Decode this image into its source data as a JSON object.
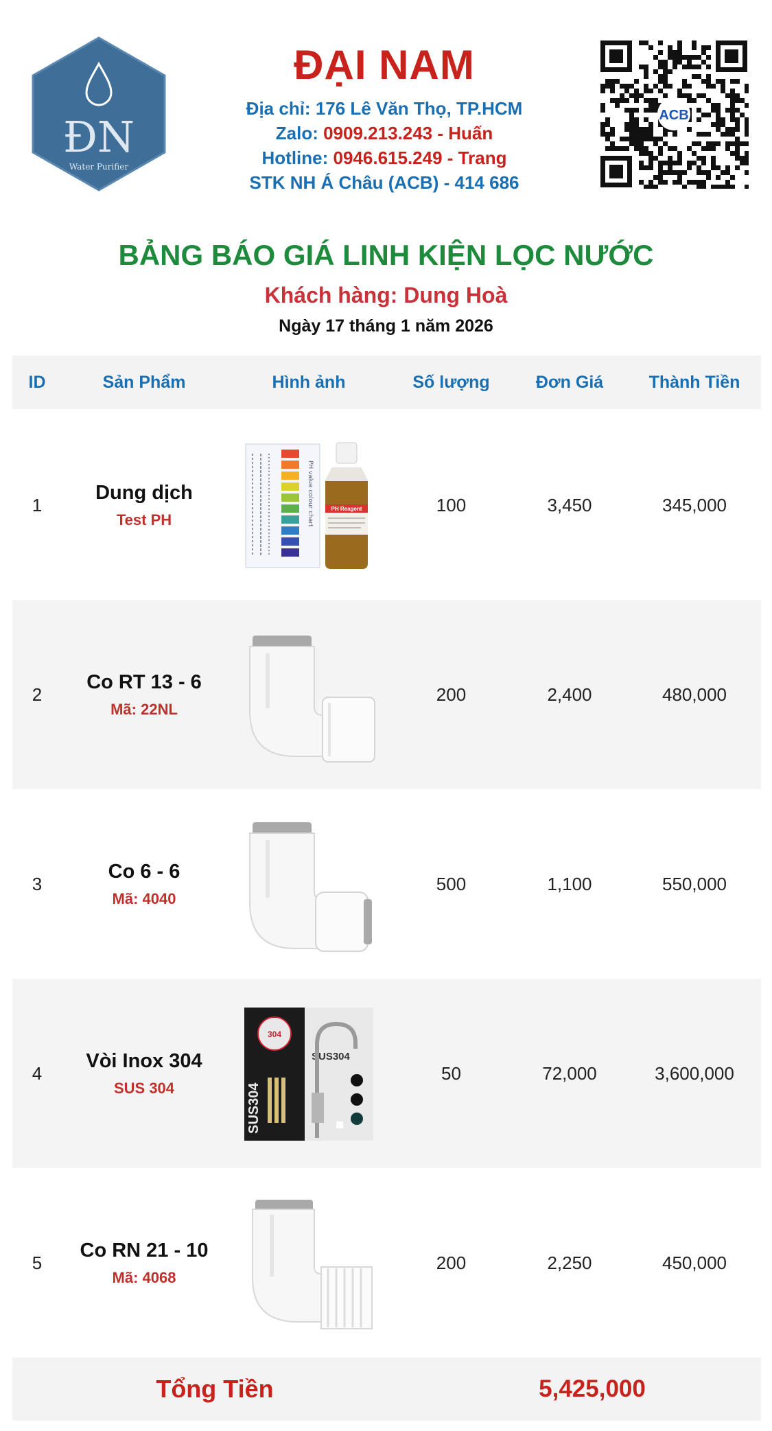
{
  "company": {
    "logo_initials": "ĐN",
    "logo_tagline": "Water Purifier",
    "name": "ĐẠI NAM",
    "address_label": "Địa chỉ:",
    "address_value": "176 Lê Văn Thọ, TP.HCM",
    "zalo_label": "Zalo:",
    "zalo_value": "0909.213.243 - Huấn",
    "hotline_label": "Hotline:",
    "hotline_value": "0946.615.249 - Trang",
    "bank_label": "STK NH Á Châu (ACB) -",
    "bank_value": "414 686",
    "qr_badge": "ACB"
  },
  "document": {
    "title": "BẢNG BÁO GIÁ LINH KIỆN LỌC NƯỚC",
    "customer": "Khách hàng: Dung Hoà",
    "date": "Ngày 17 tháng 1 năm 2026"
  },
  "table": {
    "headers": {
      "id": "ID",
      "product": "Sản Phẩm",
      "image": "Hình ảnh",
      "qty": "Số lượng",
      "price": "Đơn Giá",
      "total": "Thành Tiền"
    },
    "rows": [
      {
        "id": "1",
        "name": "Dung dịch",
        "code": "Test PH",
        "qty": "100",
        "price": "3,450",
        "total": "345,000",
        "image_icon": "ph-test-kit-image",
        "img_texts": {
          "bottle_label": "PH Reagent",
          "card_label": "PH value colour chart"
        }
      },
      {
        "id": "2",
        "name": "Co RT 13 - 6",
        "code": "Mã: 22NL",
        "qty": "200",
        "price": "2,400",
        "total": "480,000",
        "image_icon": "elbow-fitting-image"
      },
      {
        "id": "3",
        "name": "Co 6 - 6",
        "code": "Mã: 4040",
        "qty": "500",
        "price": "1,100",
        "total": "550,000",
        "image_icon": "elbow-fitting-image"
      },
      {
        "id": "4",
        "name": "Vòi Inox 304",
        "code": "SUS 304",
        "qty": "50",
        "price": "72,000",
        "total": "3,600,000",
        "image_icon": "faucet-image",
        "img_texts": {
          "box_label": "SUS304",
          "bag_label": "SUS304",
          "badge_label": "304"
        }
      },
      {
        "id": "5",
        "name": "Co RN 21 - 10",
        "code": "Mã: 4068",
        "qty": "200",
        "price": "2,250",
        "total": "450,000",
        "image_icon": "threaded-elbow-image"
      }
    ]
  },
  "summary": {
    "label": "Tổng Tiền",
    "value": "5,425,000"
  },
  "colors": {
    "brand_red": "#c8221d",
    "brand_blue": "#1a6fb3",
    "title_green": "#1e8a3c",
    "logo_blue": "#3f6e99"
  }
}
